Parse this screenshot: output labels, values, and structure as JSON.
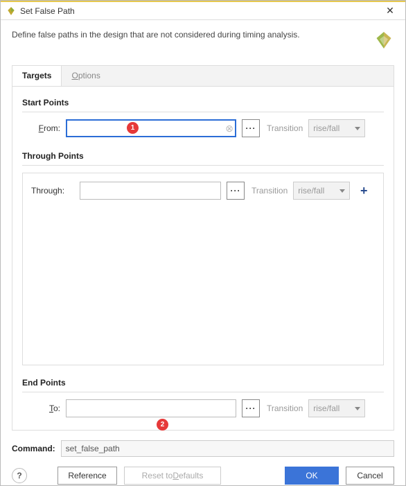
{
  "window": {
    "title": "Set False Path"
  },
  "header": {
    "description": "Define false paths in the design that are not considered during timing analysis."
  },
  "tabs": {
    "targets": "Targets",
    "options_prefix": "O",
    "options_rest": "ptions"
  },
  "sections": {
    "start": {
      "title": "Start Points",
      "from_prefix": "F",
      "from_rest": "rom:",
      "value": "",
      "transition_label": "Transition",
      "transition_value": "rise/fall"
    },
    "through": {
      "title": "Through Points",
      "label": "Through:",
      "value": "",
      "transition_label": "Transition",
      "transition_value": "rise/fall"
    },
    "end": {
      "title": "End Points",
      "to_prefix": "T",
      "to_rest": "o:",
      "value": "",
      "transition_label": "Transition",
      "transition_value": "rise/fall"
    }
  },
  "browse_label": "···",
  "command": {
    "label": "Command:",
    "value": "set_false_path"
  },
  "buttons": {
    "help": "?",
    "reference": "Reference",
    "reset_prefix": "Reset to ",
    "reset_ul": "D",
    "reset_rest": "efaults",
    "ok": "OK",
    "cancel": "Cancel"
  },
  "callouts": {
    "one": "1",
    "two": "2"
  }
}
